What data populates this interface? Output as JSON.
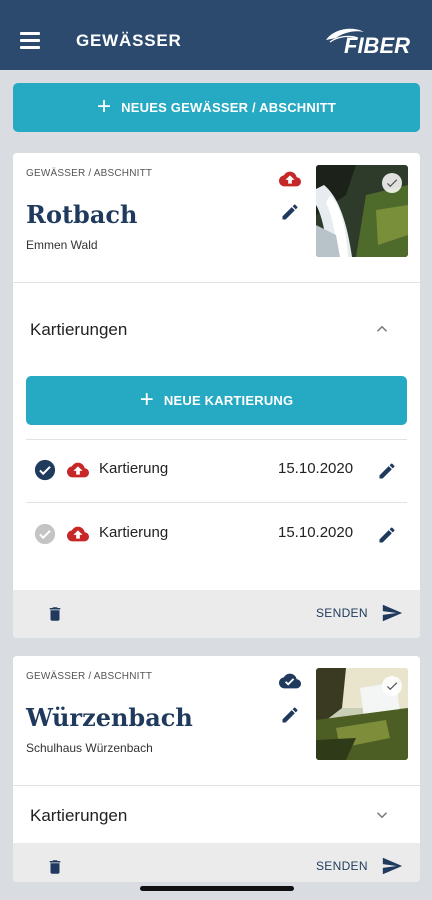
{
  "appbar": {
    "title": "GEWÄSSER",
    "logo_text": "FIBER"
  },
  "new_water_button": {
    "label": "NEUES GEWÄSSER / ABSCHNITT"
  },
  "cards": [
    {
      "kicker": "GEWÄSSER / ABSCHNITT",
      "name": "Rotbach",
      "location": "Emmen Wald",
      "cloud_status": "upload-pending",
      "section_title": "Kartierungen",
      "expanded": true,
      "new_mapping_label": "NEUE KARTIERUNG",
      "mappings": [
        {
          "label": "Kartierung",
          "date": "15.10.2020",
          "checked": true
        },
        {
          "label": "Kartierung",
          "date": "15.10.2020",
          "checked": false
        }
      ],
      "send_label": "SENDEN"
    },
    {
      "kicker": "GEWÄSSER / ABSCHNITT",
      "name": "Würzenbach",
      "location": "Schulhaus Würzenbach",
      "cloud_status": "synced",
      "section_title": "Kartierungen",
      "expanded": false,
      "send_label": "SENDEN"
    }
  ],
  "colors": {
    "appbar": "#2b4a6e",
    "accent": "#26a9c2",
    "title_text": "#1f3a5c",
    "cloud_pending": "#c62828",
    "background": "#d9dde2"
  }
}
